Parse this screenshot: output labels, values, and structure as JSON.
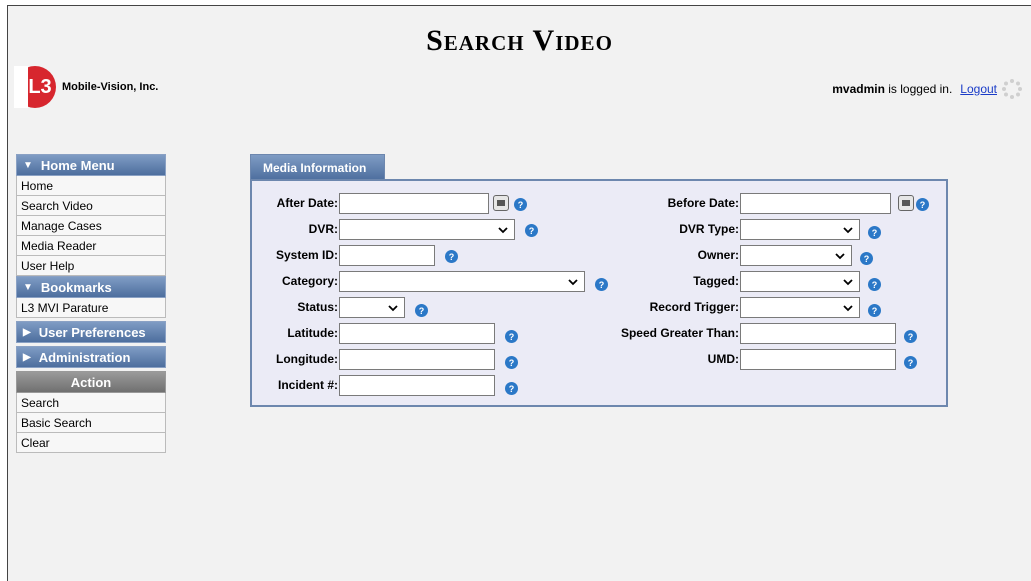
{
  "page": {
    "title": "Search Video"
  },
  "header": {
    "logo_mark": "L3",
    "company": "Mobile-Vision, Inc.",
    "user": "mvadmin",
    "logged_in_text": "is logged in.",
    "logout_label": "Logout"
  },
  "sidebar": {
    "home_menu": {
      "title": "Home Menu",
      "items": [
        "Home",
        "Search Video",
        "Manage Cases",
        "Media Reader",
        "User Help"
      ]
    },
    "bookmarks": {
      "title": "Bookmarks",
      "items": [
        "L3 MVI Parature"
      ]
    },
    "user_preferences": {
      "title": "User Preferences"
    },
    "administration": {
      "title": "Administration"
    },
    "action": {
      "title": "Action",
      "items": [
        "Search",
        "Basic Search",
        "Clear"
      ]
    }
  },
  "form": {
    "tab_label": "Media Information",
    "labels": {
      "after_date": "After Date:",
      "before_date": "Before Date:",
      "dvr": "DVR:",
      "dvr_type": "DVR Type:",
      "system_id": "System ID:",
      "owner": "Owner:",
      "category": "Category:",
      "tagged": "Tagged:",
      "status": "Status:",
      "record_trigger": "Record Trigger:",
      "latitude": "Latitude:",
      "speed_greater_than": "Speed Greater Than:",
      "longitude": "Longitude:",
      "umd": "UMD:",
      "incident": "Incident #:"
    },
    "values": {
      "after_date": "",
      "before_date": "",
      "dvr": "",
      "dvr_type": "",
      "system_id": "",
      "owner": "",
      "category": "",
      "tagged": "",
      "status": "",
      "record_trigger": "",
      "latitude": "",
      "speed_greater_than": "",
      "longitude": "",
      "umd": "",
      "incident": ""
    },
    "help_glyph": "?"
  },
  "colors": {
    "menu_blue": "#4d6e9e",
    "panel_bg": "#ebebf6",
    "link": "#1a3cc8",
    "logo_red": "#d7262e"
  },
  "icons": [
    "calendar-icon",
    "help-icon",
    "chevron-down-icon",
    "spinner-icon"
  ]
}
